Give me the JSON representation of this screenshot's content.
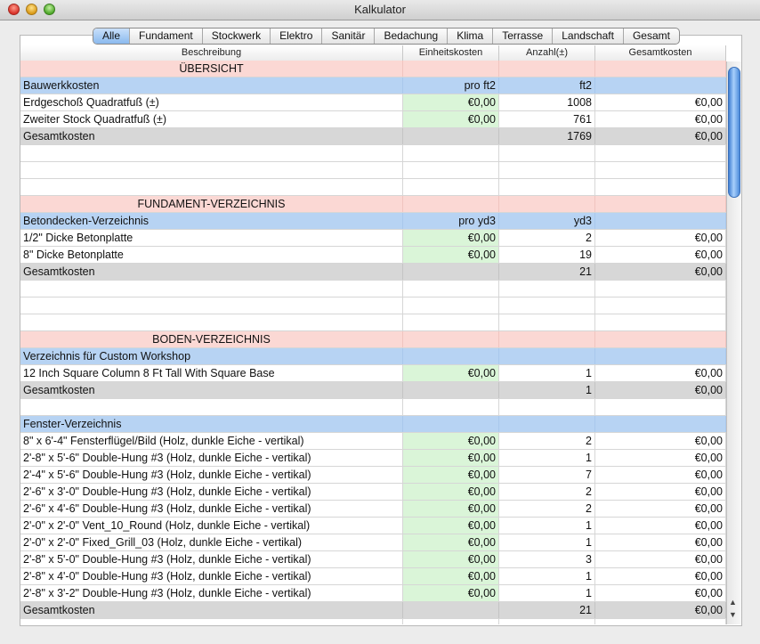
{
  "window": {
    "title": "Kalkulator"
  },
  "tabs": [
    {
      "label": "Alle",
      "active": true
    },
    {
      "label": "Fundament"
    },
    {
      "label": "Stockwerk"
    },
    {
      "label": "Elektro"
    },
    {
      "label": "Sanitär"
    },
    {
      "label": "Bedachung"
    },
    {
      "label": "Klima"
    },
    {
      "label": "Terrasse"
    },
    {
      "label": "Landschaft"
    },
    {
      "label": "Gesamt"
    }
  ],
  "columns": [
    "Beschreibung",
    "Einheitskosten",
    "Anzahl(±)",
    "Gesamtkosten"
  ],
  "rows": [
    {
      "type": "section",
      "cells": [
        "ÜBERSICHT",
        "",
        "",
        ""
      ]
    },
    {
      "type": "category",
      "cells": [
        "Bauwerkkosten",
        "pro ft2",
        "ft2",
        ""
      ]
    },
    {
      "type": "item",
      "cells": [
        "Erdgeschoß Quadratfuß (±)",
        "€0,00",
        "1008",
        "€0,00"
      ]
    },
    {
      "type": "item",
      "cells": [
        "Zweiter Stock Quadratfuß (±)",
        "€0,00",
        "761",
        "€0,00"
      ]
    },
    {
      "type": "total",
      "cells": [
        "Gesamtkosten",
        "",
        "1769",
        "€0,00"
      ]
    },
    {
      "type": "blank",
      "cells": [
        "",
        "",
        "",
        ""
      ]
    },
    {
      "type": "blank",
      "cells": [
        "",
        "",
        "",
        ""
      ]
    },
    {
      "type": "blank",
      "cells": [
        "",
        "",
        "",
        ""
      ]
    },
    {
      "type": "section",
      "cells": [
        "FUNDAMENT-VERZEICHNIS",
        "",
        "",
        ""
      ]
    },
    {
      "type": "category",
      "cells": [
        "Betondecken-Verzeichnis",
        "pro yd3",
        "yd3",
        ""
      ]
    },
    {
      "type": "item",
      "cells": [
        "1/2\" Dicke Betonplatte",
        "€0,00",
        "2",
        "€0,00"
      ]
    },
    {
      "type": "item",
      "cells": [
        "8\" Dicke Betonplatte",
        "€0,00",
        "19",
        "€0,00"
      ]
    },
    {
      "type": "total",
      "cells": [
        "Gesamtkosten",
        "",
        "21",
        "€0,00"
      ]
    },
    {
      "type": "blank",
      "cells": [
        "",
        "",
        "",
        ""
      ]
    },
    {
      "type": "blank",
      "cells": [
        "",
        "",
        "",
        ""
      ]
    },
    {
      "type": "blank",
      "cells": [
        "",
        "",
        "",
        ""
      ]
    },
    {
      "type": "section",
      "cells": [
        "BODEN-VERZEICHNIS",
        "",
        "",
        ""
      ]
    },
    {
      "type": "category",
      "cells": [
        "Verzeichnis für Custom Workshop",
        "",
        "",
        ""
      ]
    },
    {
      "type": "item",
      "cells": [
        "12 Inch Square Column 8 Ft Tall With Square Base",
        "€0,00",
        "1",
        "€0,00"
      ]
    },
    {
      "type": "total",
      "cells": [
        "Gesamtkosten",
        "",
        "1",
        "€0,00"
      ]
    },
    {
      "type": "blank",
      "cells": [
        "",
        "",
        "",
        ""
      ]
    },
    {
      "type": "category",
      "cells": [
        "Fenster-Verzeichnis",
        "",
        "",
        ""
      ]
    },
    {
      "type": "item",
      "cells": [
        "8\" x 6'-4\" Fensterflügel/Bild (Holz, dunkle Eiche - vertikal)",
        "€0,00",
        "2",
        "€0,00"
      ]
    },
    {
      "type": "item",
      "cells": [
        "2'-8\" x 5'-6\" Double-Hung #3 (Holz, dunkle Eiche - vertikal)",
        "€0,00",
        "1",
        "€0,00"
      ]
    },
    {
      "type": "item",
      "cells": [
        "2'-4\" x 5'-6\" Double-Hung #3 (Holz, dunkle Eiche - vertikal)",
        "€0,00",
        "7",
        "€0,00"
      ]
    },
    {
      "type": "item",
      "cells": [
        "2'-6\" x 3'-0\" Double-Hung #3 (Holz, dunkle Eiche - vertikal)",
        "€0,00",
        "2",
        "€0,00"
      ]
    },
    {
      "type": "item",
      "cells": [
        "2'-6\" x 4'-6\" Double-Hung #3 (Holz, dunkle Eiche - vertikal)",
        "€0,00",
        "2",
        "€0,00"
      ]
    },
    {
      "type": "item",
      "cells": [
        "2'-0\" x 2'-0\" Vent_10_Round (Holz, dunkle Eiche - vertikal)",
        "€0,00",
        "1",
        "€0,00"
      ]
    },
    {
      "type": "item",
      "cells": [
        "2'-0\" x 2'-0\" Fixed_Grill_03 (Holz, dunkle Eiche - vertikal)",
        "€0,00",
        "1",
        "€0,00"
      ]
    },
    {
      "type": "item",
      "cells": [
        "2'-8\" x 5'-0\" Double-Hung #3 (Holz, dunkle Eiche - vertikal)",
        "€0,00",
        "3",
        "€0,00"
      ]
    },
    {
      "type": "item",
      "cells": [
        "2'-8\" x 4'-0\" Double-Hung #3 (Holz, dunkle Eiche - vertikal)",
        "€0,00",
        "1",
        "€0,00"
      ]
    },
    {
      "type": "item",
      "cells": [
        "2'-8\" x 3'-2\" Double-Hung #3 (Holz, dunkle Eiche - vertikal)",
        "€0,00",
        "1",
        "€0,00"
      ]
    },
    {
      "type": "total",
      "cells": [
        "Gesamtkosten",
        "",
        "21",
        "€0,00"
      ]
    },
    {
      "type": "blank",
      "cells": [
        "",
        "",
        "",
        ""
      ]
    }
  ],
  "scrollbar": {
    "up_icon": "▲",
    "down_icon": "▼"
  }
}
